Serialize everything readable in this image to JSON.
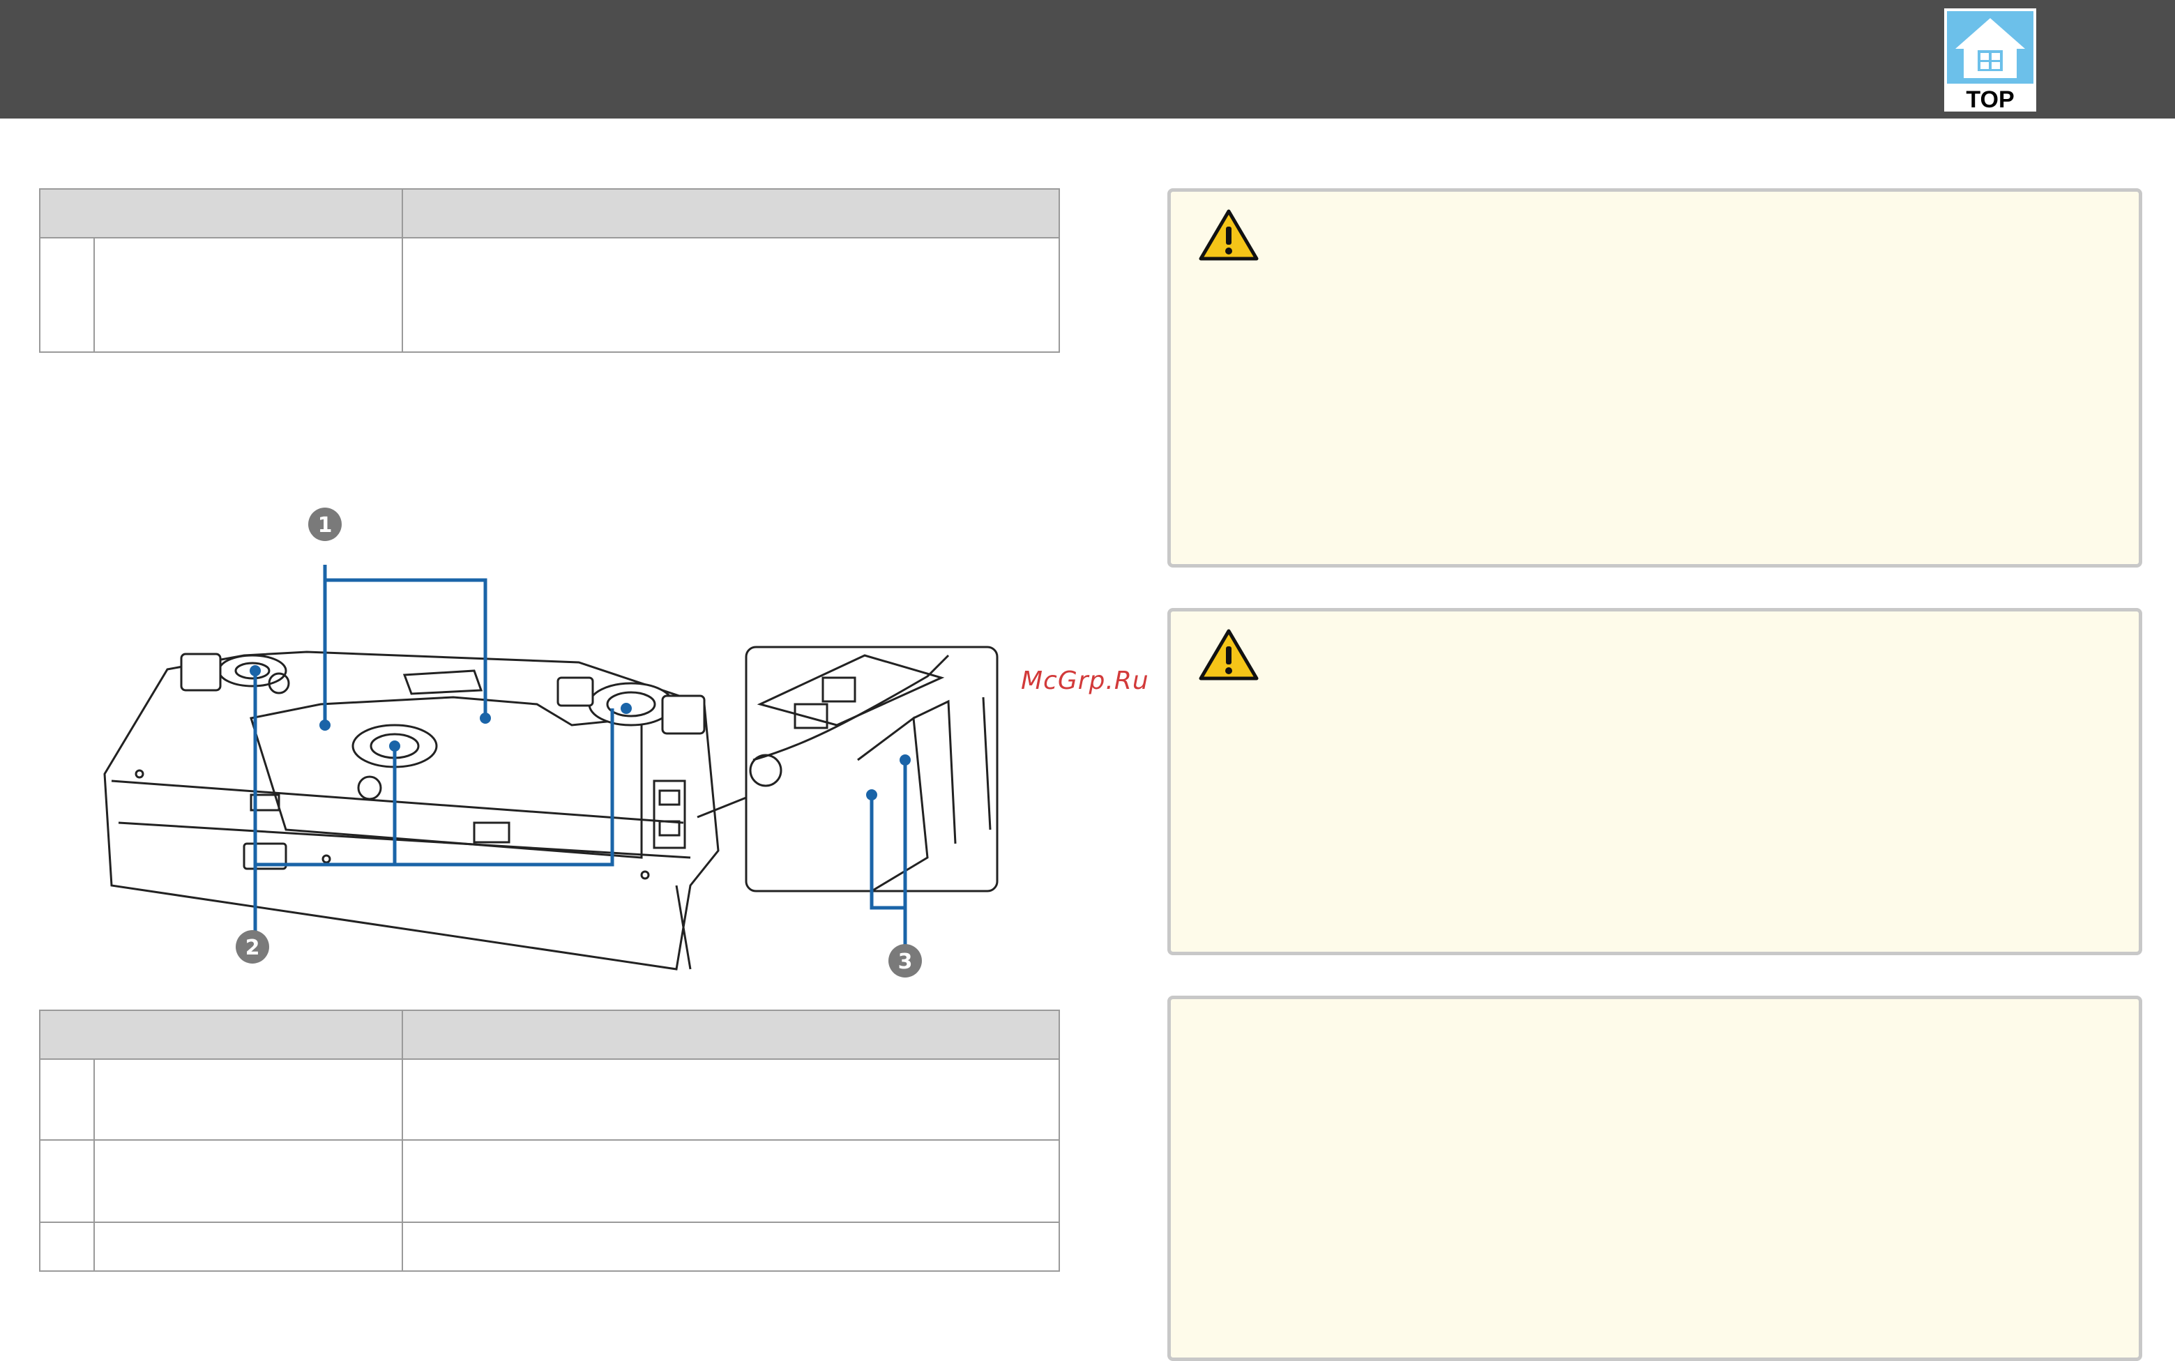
{
  "header": {
    "top_label": "TOP"
  },
  "watermark": "McGrp.Ru",
  "illustration": {
    "callouts": [
      "1",
      "2",
      "3"
    ]
  },
  "colors": {
    "header_bg": "#4d4d4d",
    "callout_line": "#1a64a8",
    "note_bg": "#fefbea",
    "top_icon": "#5fb3e0"
  },
  "icons": [
    "warning-icon",
    "top-home-icon"
  ]
}
